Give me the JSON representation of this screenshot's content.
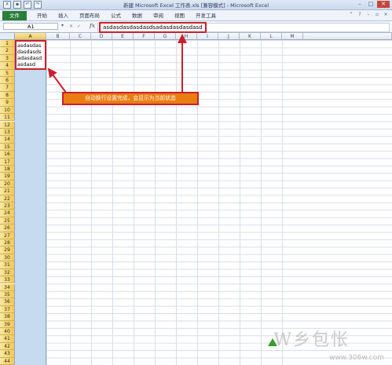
{
  "window": {
    "title": "新建 Microsoft Excel 工作表.xls [兼容模式] - Microsoft Excel",
    "controls": [
      "–",
      "□",
      "✕"
    ]
  },
  "ribbon": {
    "file_tab": "文件",
    "tabs": [
      "开始",
      "插入",
      "页面布局",
      "公式",
      "数据",
      "审阅",
      "视图",
      "开发工具"
    ]
  },
  "formula_bar": {
    "name_box": "A1",
    "fx": "fx",
    "value": "asdasdasdasdasdsadasdasdasdasd"
  },
  "columns": [
    "A",
    "B",
    "C",
    "D",
    "E",
    "F",
    "G",
    "H",
    "I",
    "J",
    "K",
    "L",
    "M"
  ],
  "rows": [
    "1",
    "2",
    "3",
    "4",
    "5",
    "6",
    "7",
    "8",
    "9",
    "10",
    "11",
    "12",
    "13",
    "14",
    "15",
    "16",
    "17",
    "18",
    "19",
    "20",
    "21",
    "22",
    "23",
    "24",
    "25",
    "26",
    "27",
    "28",
    "29",
    "30",
    "31",
    "32",
    "33",
    "34",
    "35",
    "36",
    "37",
    "38",
    "39",
    "40",
    "41",
    "42",
    "43",
    "44"
  ],
  "cell_a1": "asdasdasdasdasdsadasdasdasdasd",
  "callout": "自动换行设置完成，会显示为当前状态",
  "watermark": {
    "logo": "W乡包怅",
    "url": "www.306w.com"
  },
  "colors": {
    "accent_red": "#c8202d",
    "callout_orange": "#ea7d12",
    "selected_header": "#f0c85a",
    "file_tab_green": "#2b7d3a"
  }
}
